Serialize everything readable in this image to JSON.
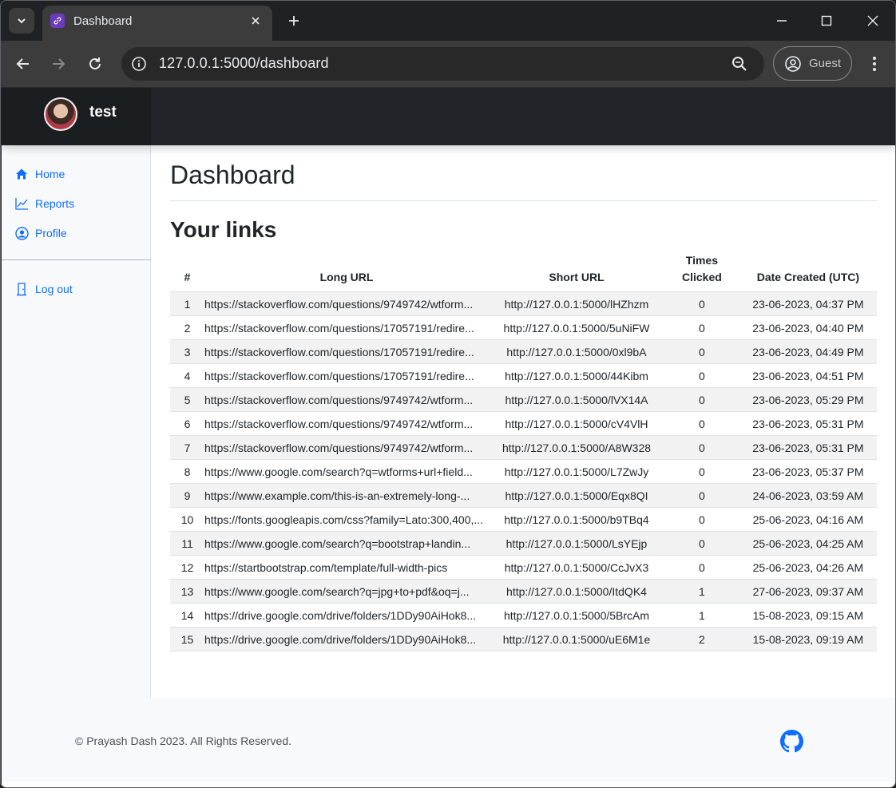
{
  "browser": {
    "tab_title": "Dashboard",
    "url": "127.0.0.1:5000/dashboard",
    "profile_label": "Guest"
  },
  "topbar": {
    "username": "test"
  },
  "sidebar": {
    "items": [
      {
        "label": "Home",
        "icon": "home-icon"
      },
      {
        "label": "Reports",
        "icon": "chart-line-icon"
      },
      {
        "label": "Profile",
        "icon": "user-circle-icon"
      }
    ],
    "logout_label": "Log out"
  },
  "main": {
    "title": "Dashboard",
    "section_title": "Your links",
    "table": {
      "headers": [
        "#",
        "Long URL",
        "Short URL",
        "Times Clicked",
        "Date Created (UTC)"
      ],
      "rows": [
        [
          "1",
          "https://stackoverflow.com/questions/9749742/wtform...",
          "http://127.0.0.1:5000/lHZhzm",
          "0",
          "23-06-2023, 04:37 PM"
        ],
        [
          "2",
          "https://stackoverflow.com/questions/17057191/redire...",
          "http://127.0.0.1:5000/5uNiFW",
          "0",
          "23-06-2023, 04:40 PM"
        ],
        [
          "3",
          "https://stackoverflow.com/questions/17057191/redire...",
          "http://127.0.0.1:5000/0xl9bA",
          "0",
          "23-06-2023, 04:49 PM"
        ],
        [
          "4",
          "https://stackoverflow.com/questions/17057191/redire...",
          "http://127.0.0.1:5000/44Kibm",
          "0",
          "23-06-2023, 04:51 PM"
        ],
        [
          "5",
          "https://stackoverflow.com/questions/9749742/wtform...",
          "http://127.0.0.1:5000/lVX14A",
          "0",
          "23-06-2023, 05:29 PM"
        ],
        [
          "6",
          "https://stackoverflow.com/questions/9749742/wtform...",
          "http://127.0.0.1:5000/cV4VlH",
          "0",
          "23-06-2023, 05:31 PM"
        ],
        [
          "7",
          "https://stackoverflow.com/questions/9749742/wtform...",
          "http://127.0.0.1:5000/A8W328",
          "0",
          "23-06-2023, 05:31 PM"
        ],
        [
          "8",
          "https://www.google.com/search?q=wtforms+url+field...",
          "http://127.0.0.1:5000/L7ZwJy",
          "0",
          "23-06-2023, 05:37 PM"
        ],
        [
          "9",
          "https://www.example.com/this-is-an-extremely-long-...",
          "http://127.0.0.1:5000/Eqx8QI",
          "0",
          "24-06-2023, 03:59 AM"
        ],
        [
          "10",
          "https://fonts.googleapis.com/css?family=Lato:300,400,...",
          "http://127.0.0.1:5000/b9TBq4",
          "0",
          "25-06-2023, 04:16 AM"
        ],
        [
          "11",
          "https://www.google.com/search?q=bootstrap+landin...",
          "http://127.0.0.1:5000/LsYEjp",
          "0",
          "25-06-2023, 04:25 AM"
        ],
        [
          "12",
          "https://startbootstrap.com/template/full-width-pics",
          "http://127.0.0.1:5000/CcJvX3",
          "0",
          "25-06-2023, 04:26 AM"
        ],
        [
          "13",
          "https://www.google.com/search?q=jpg+to+pdf&oq=j...",
          "http://127.0.0.1:5000/ItdQK4",
          "1",
          "27-06-2023, 09:37 AM"
        ],
        [
          "14",
          "https://drive.google.com/drive/folders/1DDy90AiHok8...",
          "http://127.0.0.1:5000/5BrcAm",
          "1",
          "15-08-2023, 09:15 AM"
        ],
        [
          "15",
          "https://drive.google.com/drive/folders/1DDy90AiHok8...",
          "http://127.0.0.1:5000/uE6M1e",
          "2",
          "15-08-2023, 09:19 AM"
        ]
      ]
    }
  },
  "footer": {
    "copyright": "© Prayash Dash 2023. All Rights Reserved."
  },
  "colors": {
    "link_blue": "#0d6efd",
    "topbar_dark": "#212529",
    "stripe": "#f2f2f2"
  }
}
